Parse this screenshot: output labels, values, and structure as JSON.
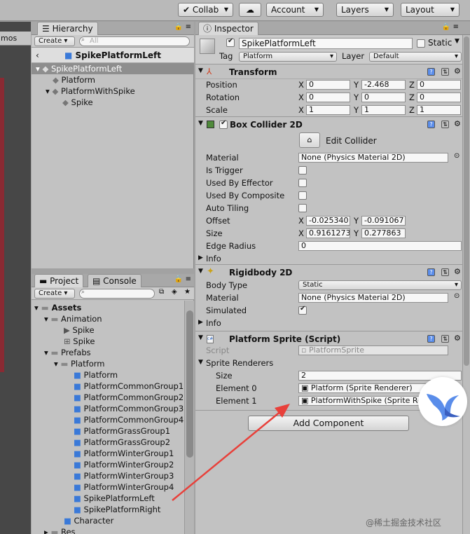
{
  "toolbar": {
    "collab": "Collab",
    "account": "Account",
    "layers": "Layers",
    "layout": "Layout",
    "left_fragment": "mos"
  },
  "hierarchy": {
    "tab": "Hierarchy",
    "create": "Create",
    "search_placeholder": "All",
    "scene": "SpikePlatformLeft",
    "items": [
      {
        "label": "SpikePlatformLeft"
      },
      {
        "label": "Platform"
      },
      {
        "label": "PlatformWithSpike"
      },
      {
        "label": "Spike"
      }
    ]
  },
  "project": {
    "tab_project": "Project",
    "tab_console": "Console",
    "create": "Create",
    "items": [
      {
        "label": "Assets"
      },
      {
        "label": "Animation"
      },
      {
        "label": "Spike"
      },
      {
        "label": "Spike"
      },
      {
        "label": "Prefabs"
      },
      {
        "label": "Platform"
      },
      {
        "label": "Platform"
      },
      {
        "label": "PlatformCommonGroup1"
      },
      {
        "label": "PlatformCommonGroup2"
      },
      {
        "label": "PlatformCommonGroup3"
      },
      {
        "label": "PlatformCommonGroup4"
      },
      {
        "label": "PlatformGrassGroup1"
      },
      {
        "label": "PlatformGrassGroup2"
      },
      {
        "label": "PlatformWinterGroup1"
      },
      {
        "label": "PlatformWinterGroup2"
      },
      {
        "label": "PlatformWinterGroup3"
      },
      {
        "label": "PlatformWinterGroup4"
      },
      {
        "label": "SpikePlatformLeft"
      },
      {
        "label": "SpikePlatformRight"
      },
      {
        "label": "Character"
      },
      {
        "label": "Res"
      }
    ]
  },
  "inspector": {
    "tab": "Inspector",
    "object_name": "SpikePlatformLeft",
    "static": "Static",
    "tag_label": "Tag",
    "tag_value": "Platform",
    "layer_label": "Layer",
    "layer_value": "Default",
    "transform": {
      "title": "Transform",
      "position": {
        "label": "Position",
        "x": "0",
        "y": "-2.468",
        "z": "0"
      },
      "rotation": {
        "label": "Rotation",
        "x": "0",
        "y": "0",
        "z": "0"
      },
      "scale": {
        "label": "Scale",
        "x": "1",
        "y": "1",
        "z": "1"
      },
      "axis_x": "X",
      "axis_y": "Y",
      "axis_z": "Z"
    },
    "box_collider": {
      "title": "Box Collider 2D",
      "edit": "Edit Collider",
      "material_label": "Material",
      "material_value": "None (Physics Material 2D)",
      "is_trigger": "Is Trigger",
      "used_by_effector": "Used By Effector",
      "used_by_composite": "Used By Composite",
      "auto_tiling": "Auto Tiling",
      "offset_label": "Offset",
      "offset_x": "-0.025340",
      "offset_y": "-0.091067",
      "size_label": "Size",
      "size_x": "0.9161273",
      "size_y": "0.277863",
      "edge_radius_label": "Edge Radius",
      "edge_radius": "0",
      "info": "Info"
    },
    "rigidbody": {
      "title": "Rigidbody 2D",
      "body_type_label": "Body Type",
      "body_type": "Static",
      "material_label": "Material",
      "material_value": "None (Physics Material 2D)",
      "simulated": "Simulated",
      "info": "Info"
    },
    "platform_sprite": {
      "title": "Platform Sprite (Script)",
      "script_label": "Script",
      "script_value": "PlatformSprite",
      "renderers_label": "Sprite Renderers",
      "size_label": "Size",
      "size_value": "2",
      "element0_label": "Element 0",
      "element0_value": "Platform (Sprite Renderer)",
      "element1_label": "Element 1",
      "element1_value": "PlatformWithSpike (Sprite Renderer)"
    },
    "add_component": "Add Component"
  },
  "watermark": "@稀土掘金技术社区",
  "colors": {
    "arrow": "#e8403a",
    "bird": "#5a8dea"
  }
}
